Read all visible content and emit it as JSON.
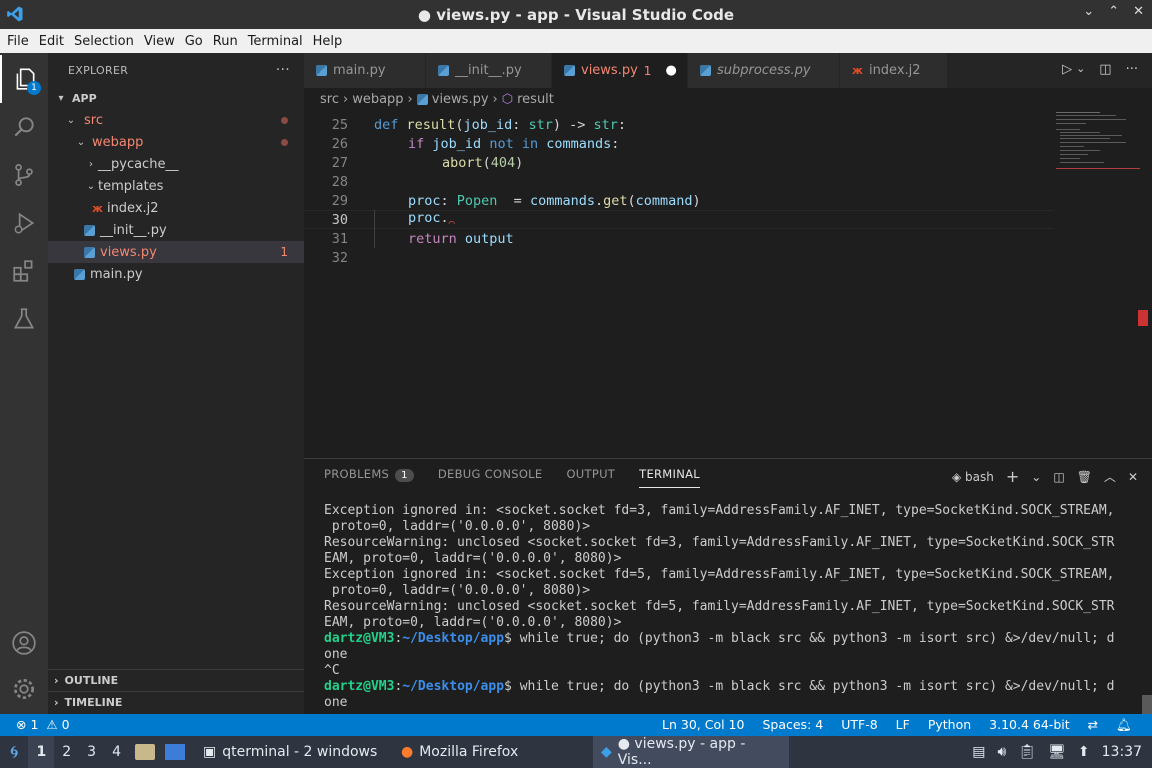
{
  "window": {
    "title": "● views.py - app - Visual Studio Code",
    "controls": [
      "⌄",
      "⌃",
      "✕"
    ]
  },
  "menu": [
    "File",
    "Edit",
    "Selection",
    "View",
    "Go",
    "Run",
    "Terminal",
    "Help"
  ],
  "activity": {
    "explorer_badge": "1"
  },
  "sidebar": {
    "title": "EXPLORER",
    "more": "···",
    "root": "APP",
    "tree": [
      {
        "label": "src"
      },
      {
        "label": "webapp"
      },
      {
        "label": "__pycache__"
      },
      {
        "label": "templates"
      },
      {
        "label": "index.j2"
      },
      {
        "label": "__init__.py"
      },
      {
        "label": "views.py",
        "problems": "1"
      },
      {
        "label": "main.py"
      }
    ],
    "outline": "OUTLINE",
    "timeline": "TIMELINE"
  },
  "tabs": [
    {
      "label": "main.py"
    },
    {
      "label": "__init__.py"
    },
    {
      "label": "views.py",
      "problems": "1",
      "dirty": "●"
    },
    {
      "label": "subprocess.py"
    },
    {
      "label": "index.j2"
    }
  ],
  "breadcrumb": [
    "src",
    "›",
    "webapp",
    "›",
    "views.py",
    "›",
    "result"
  ],
  "editor": {
    "line_numbers": [
      "25",
      "26",
      "27",
      "28",
      "29",
      "30",
      "31",
      "32"
    ],
    "line25": {
      "def": "def",
      "name": "result",
      "p1": "(",
      "arg": "job_id",
      "colon": ": ",
      "type": "str",
      "p2": ") -> ",
      "ret": "str",
      "end": ":"
    },
    "line26": {
      "if": "if",
      "var": "job_id",
      "not": "not",
      "in": "in",
      "obj": "commands",
      "end": ":"
    },
    "line27": {
      "fn": "abort",
      "p1": "(",
      "num": "404",
      "p2": ")"
    },
    "line29": {
      "var": "proc",
      "colon": ": ",
      "type": "Popen",
      "eq": "  = ",
      "obj": "commands",
      "dot": ".",
      "fn": "get",
      "p1": "(",
      "arg": "command",
      "p2": ")"
    },
    "line30": {
      "var": "proc",
      "dot": "."
    },
    "line31": {
      "kw": "return",
      "var": "output"
    }
  },
  "panel": {
    "tabs": [
      {
        "label": "PROBLEMS"
      },
      {
        "label": "DEBUG CONSOLE"
      },
      {
        "label": "OUTPUT"
      },
      {
        "label": "TERMINAL"
      }
    ],
    "problems_count": "1",
    "shell": "bash",
    "actions": [
      "+",
      "⌄",
      "◫",
      "🗑",
      "︿",
      "✕"
    ]
  },
  "terminal": {
    "lines": [
      "Exception ignored in: <socket.socket fd=3, family=AddressFamily.AF_INET, type=SocketKind.SOCK_STREAM,",
      " proto=0, laddr=('0.0.0.0', 8080)>",
      "ResourceWarning: unclosed <socket.socket fd=3, family=AddressFamily.AF_INET, type=SocketKind.SOCK_STR",
      "EAM, proto=0, laddr=('0.0.0.0', 8080)>",
      "Exception ignored in: <socket.socket fd=5, family=AddressFamily.AF_INET, type=SocketKind.SOCK_STREAM,",
      " proto=0, laddr=('0.0.0.0', 8080)>",
      "ResourceWarning: unclosed <socket.socket fd=5, family=AddressFamily.AF_INET, type=SocketKind.SOCK_STR",
      "EAM, proto=0, laddr=('0.0.0.0', 8080)>"
    ],
    "prompt_user": "dartz@VM3",
    "prompt_sep": ":",
    "prompt_path": "~/Desktop/app",
    "prompt_dollar": "$ ",
    "cmd1": "while true; do (python3 -m black src && python3 -m isort src) &>/dev/null; d",
    "cmd1_cont": "one",
    "interrupt": "^C",
    "cmd2": "while true; do (python3 -m black src && python3 -m isort src) &>/dev/null; d",
    "cmd2_cont": "one"
  },
  "status": {
    "errors": "⊗ 1",
    "warnings": "⚠ 0",
    "position": "Ln 30, Col 10",
    "spaces": "Spaces: 4",
    "encoding": "UTF-8",
    "eol": "LF",
    "language": "Python",
    "interpreter": "3.10.4 64-bit"
  },
  "taskbar": {
    "workspaces": [
      "1",
      "2",
      "3",
      "4"
    ],
    "tasks": [
      "qterminal - 2 windows",
      "Mozilla Firefox",
      "● views.py - app - Vis..."
    ],
    "clock": "13:37"
  },
  "colors": {
    "accent": "#007acc",
    "error": "#f48771",
    "activity_bg": "#333333",
    "sidebar_bg": "#252526",
    "editor_bg": "#1e1e1e"
  }
}
